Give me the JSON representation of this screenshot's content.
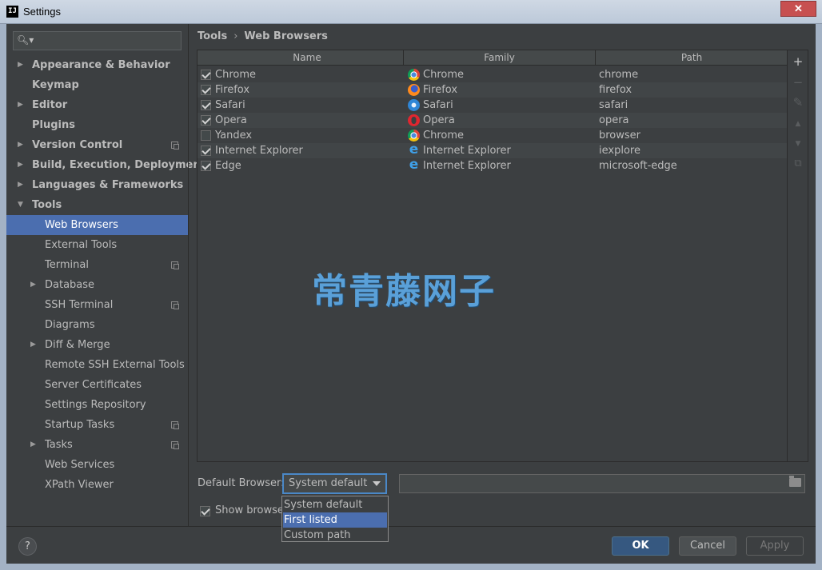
{
  "window": {
    "title": "Settings",
    "close_label": "✕"
  },
  "search": {
    "icon": "search-icon",
    "placeholder": ""
  },
  "sidebar": {
    "items": [
      {
        "label": "Appearance & Behavior",
        "level": 0,
        "arrow": "right",
        "bold": true,
        "cfg": false,
        "selected": false
      },
      {
        "label": "Keymap",
        "level": 0,
        "arrow": "none",
        "bold": true,
        "cfg": false,
        "selected": false
      },
      {
        "label": "Editor",
        "level": 0,
        "arrow": "right",
        "bold": true,
        "cfg": false,
        "selected": false
      },
      {
        "label": "Plugins",
        "level": 0,
        "arrow": "none",
        "bold": true,
        "cfg": false,
        "selected": false
      },
      {
        "label": "Version Control",
        "level": 0,
        "arrow": "right",
        "bold": true,
        "cfg": true,
        "selected": false
      },
      {
        "label": "Build, Execution, Deployment",
        "level": 0,
        "arrow": "right",
        "bold": true,
        "cfg": false,
        "selected": false
      },
      {
        "label": "Languages & Frameworks",
        "level": 0,
        "arrow": "right",
        "bold": true,
        "cfg": false,
        "selected": false
      },
      {
        "label": "Tools",
        "level": 0,
        "arrow": "down",
        "bold": true,
        "cfg": false,
        "selected": false
      },
      {
        "label": "Web Browsers",
        "level": 1,
        "arrow": "none",
        "bold": false,
        "cfg": false,
        "selected": true
      },
      {
        "label": "External Tools",
        "level": 1,
        "arrow": "none",
        "bold": false,
        "cfg": false,
        "selected": false
      },
      {
        "label": "Terminal",
        "level": 1,
        "arrow": "none",
        "bold": false,
        "cfg": true,
        "selected": false
      },
      {
        "label": "Database",
        "level": 1,
        "arrow": "right",
        "bold": false,
        "cfg": false,
        "selected": false
      },
      {
        "label": "SSH Terminal",
        "level": 1,
        "arrow": "none",
        "bold": false,
        "cfg": true,
        "selected": false
      },
      {
        "label": "Diagrams",
        "level": 1,
        "arrow": "none",
        "bold": false,
        "cfg": false,
        "selected": false
      },
      {
        "label": "Diff & Merge",
        "level": 1,
        "arrow": "right",
        "bold": false,
        "cfg": false,
        "selected": false
      },
      {
        "label": "Remote SSH External Tools",
        "level": 1,
        "arrow": "none",
        "bold": false,
        "cfg": false,
        "selected": false
      },
      {
        "label": "Server Certificates",
        "level": 1,
        "arrow": "none",
        "bold": false,
        "cfg": false,
        "selected": false
      },
      {
        "label": "Settings Repository",
        "level": 1,
        "arrow": "none",
        "bold": false,
        "cfg": false,
        "selected": false
      },
      {
        "label": "Startup Tasks",
        "level": 1,
        "arrow": "none",
        "bold": false,
        "cfg": true,
        "selected": false
      },
      {
        "label": "Tasks",
        "level": 1,
        "arrow": "right",
        "bold": false,
        "cfg": true,
        "selected": false
      },
      {
        "label": "Web Services",
        "level": 1,
        "arrow": "none",
        "bold": false,
        "cfg": false,
        "selected": false
      },
      {
        "label": "XPath Viewer",
        "level": 1,
        "arrow": "none",
        "bold": false,
        "cfg": false,
        "selected": false
      }
    ]
  },
  "breadcrumb": {
    "parent": "Tools",
    "separator": "›",
    "current": "Web Browsers"
  },
  "table": {
    "headers": [
      "Name",
      "Family",
      "Path"
    ],
    "rows": [
      {
        "checked": true,
        "name": "Chrome",
        "family": "Chrome",
        "family_icon": "chrome-icon",
        "path": "chrome"
      },
      {
        "checked": true,
        "name": "Firefox",
        "family": "Firefox",
        "family_icon": "firefox-icon",
        "path": "firefox"
      },
      {
        "checked": true,
        "name": "Safari",
        "family": "Safari",
        "family_icon": "safari-icon",
        "path": "safari"
      },
      {
        "checked": true,
        "name": "Opera",
        "family": "Opera",
        "family_icon": "opera-icon",
        "path": "opera"
      },
      {
        "checked": false,
        "name": "Yandex",
        "family": "Chrome",
        "family_icon": "chrome-icon",
        "path": "browser"
      },
      {
        "checked": true,
        "name": "Internet Explorer",
        "family": "Internet Explorer",
        "family_icon": "ie-icon",
        "path": "iexplore"
      },
      {
        "checked": true,
        "name": "Edge",
        "family": "Internet Explorer",
        "family_icon": "ie-icon",
        "path": "microsoft-edge"
      }
    ]
  },
  "toolbar": {
    "add": "+",
    "remove": "−",
    "edit": "✎",
    "up": "▲",
    "down": "▼",
    "copy": "⧉"
  },
  "watermark": "常青藤网子",
  "default_browser": {
    "label": "Default Browser:",
    "selected": "System default",
    "options": [
      "System default",
      "First listed",
      "Custom path"
    ],
    "highlighted": "First listed",
    "path_value": ""
  },
  "show_browser": {
    "checked": true,
    "label": "Show browser"
  },
  "buttons": {
    "help": "?",
    "ok": "OK",
    "cancel": "Cancel",
    "apply": "Apply"
  },
  "colors": {
    "selection": "#4b6eaf",
    "ok_button": "#365880",
    "watermark": "#5aa0d8"
  }
}
